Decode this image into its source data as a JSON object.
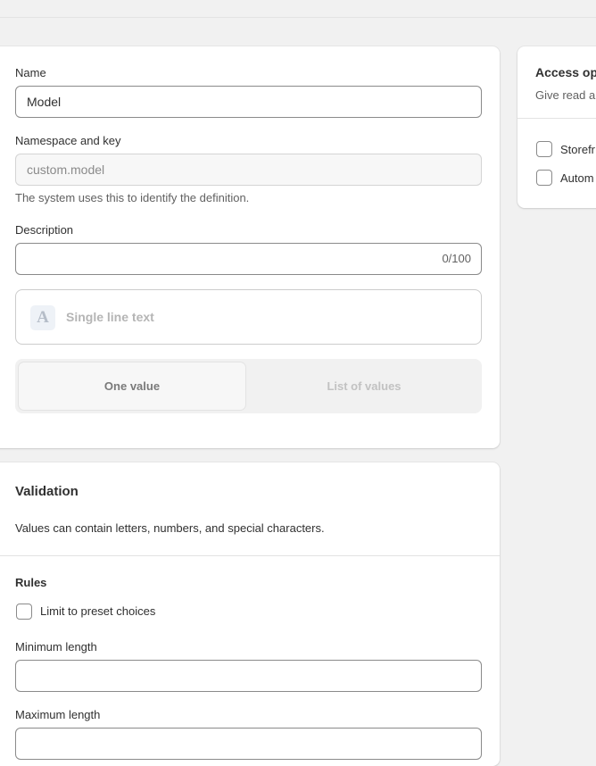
{
  "definition": {
    "name_label": "Name",
    "name_value": "Model",
    "namespace_label": "Namespace and key",
    "namespace_value": "custom.model",
    "namespace_help": "The system uses this to identify the definition.",
    "description_label": "Description",
    "description_value": "",
    "description_counter": "0/100",
    "type_icon": "text-type-icon",
    "type_icon_glyph": "A",
    "type_label": "Single line text",
    "value_options": [
      "One value",
      "List of values"
    ],
    "selected_value_option": "One value"
  },
  "validation": {
    "title": "Validation",
    "description": "Values can contain letters, numbers, and special characters.",
    "rules_label": "Rules",
    "limit_preset_label": "Limit to preset choices",
    "limit_preset_checked": false,
    "min_length_label": "Minimum length",
    "min_length_value": "",
    "max_length_label": "Maximum length",
    "max_length_value": ""
  },
  "access": {
    "title": "Access op",
    "subtitle": "Give read a",
    "options": [
      {
        "label": "Storefr",
        "checked": false
      },
      {
        "label": "Autom",
        "checked": false
      }
    ]
  }
}
